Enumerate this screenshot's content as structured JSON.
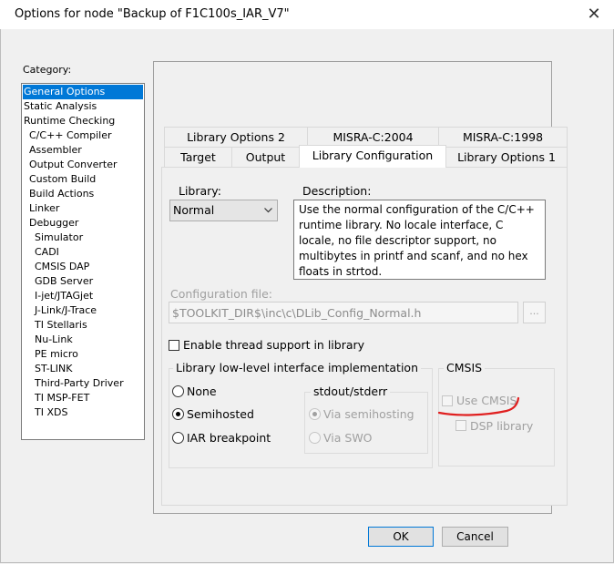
{
  "window": {
    "title": "Options for node \"Backup of F1C100s_IAR_V7\"",
    "close_glyph": "✕"
  },
  "category": {
    "label": "Category:",
    "items": [
      "General Options",
      "Static Analysis",
      "Runtime Checking",
      "C/C++ Compiler",
      "Assembler",
      "Output Converter",
      "Custom Build",
      "Build Actions",
      "Linker",
      "Debugger",
      "Simulator",
      "CADI",
      "CMSIS DAP",
      "GDB Server",
      "I-jet/JTAGjet",
      "J-Link/J-Trace",
      "TI Stellaris",
      "Nu-Link",
      "PE micro",
      "ST-LINK",
      "Third-Party Driver",
      "TI MSP-FET",
      "TI XDS"
    ],
    "selected": "General Options"
  },
  "tabs": {
    "back_row": [
      "Library Options 2",
      "MISRA-C:2004",
      "MISRA-C:1998"
    ],
    "front_row": [
      "Target",
      "Output",
      "Library Configuration",
      "Library Options 1"
    ],
    "active": "Library Configuration"
  },
  "library": {
    "label": "Library:",
    "value": "Normal",
    "description_label": "Description:",
    "description": "Use the normal configuration of the C/C++ runtime library. No locale interface, C locale, no file descriptor support, no multibytes in printf and scanf, and no hex floats in strtod."
  },
  "config_file": {
    "label": "Configuration file:",
    "value": "$TOOLKIT_DIR$\\inc\\c\\DLib_Config_Normal.h",
    "browse_label": "..."
  },
  "thread_support": {
    "label": "Enable thread support in library",
    "checked": false
  },
  "lowlevel": {
    "title": "Library low-level interface implementation",
    "options": [
      "None",
      "Semihosted",
      "IAR breakpoint"
    ],
    "selected": "Semihosted",
    "stdout": {
      "title": "stdout/stderr",
      "options": [
        "Via semihosting",
        "Via SWO"
      ],
      "selected": "Via semihosting"
    }
  },
  "cmsis": {
    "title": "CMSIS",
    "use_cmsis": "Use CMSIS",
    "dsp_library": "DSP library",
    "annotation_color": "#e02020"
  },
  "buttons": {
    "ok": "OK",
    "cancel": "Cancel"
  }
}
